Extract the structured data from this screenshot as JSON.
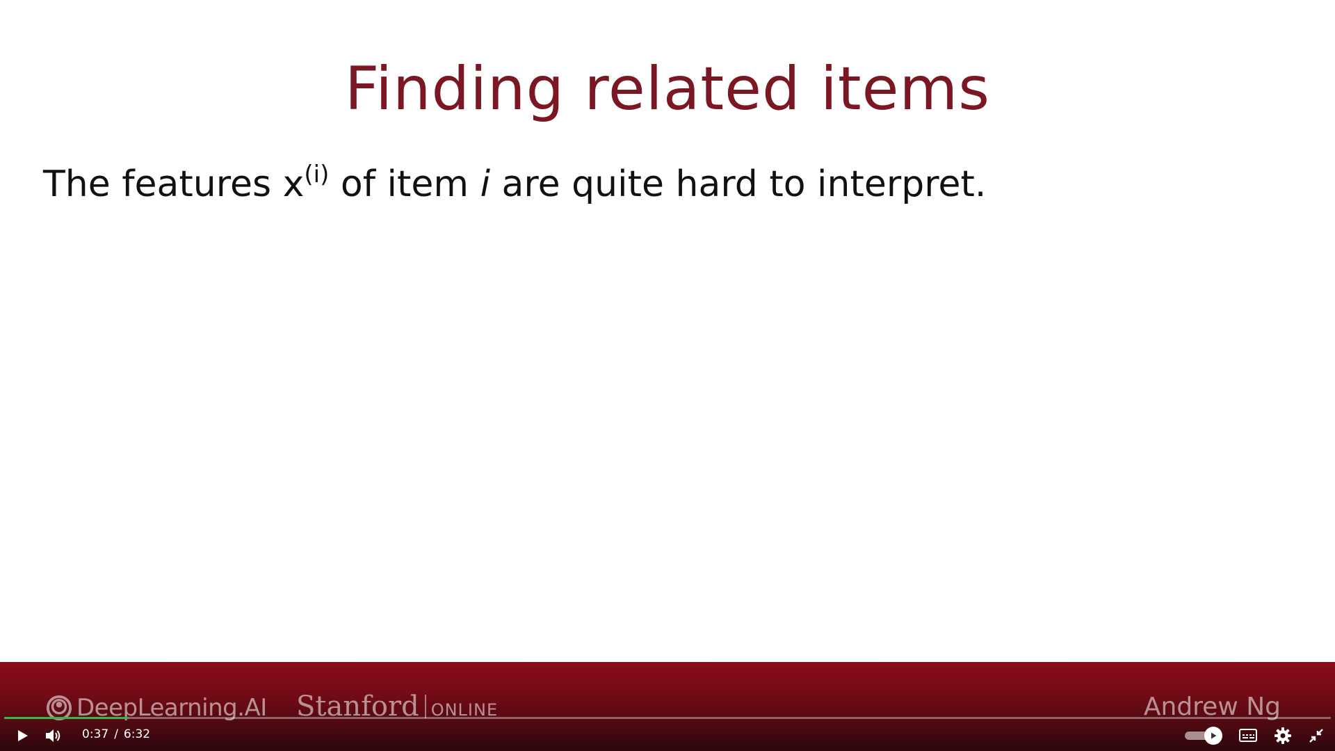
{
  "slide": {
    "title": "Finding related items",
    "body_prefix": "The features x",
    "body_superscript": "(i)",
    "body_mid": " of item ",
    "body_italic": "i",
    "body_suffix": " are quite hard to interpret."
  },
  "footer": {
    "brand_deeplearning": "DeepLearning.AI",
    "brand_stanford": "Stanford",
    "brand_online": "ONLINE",
    "author": "Andrew Ng"
  },
  "player": {
    "current_time": "0:37",
    "time_separator": "/",
    "duration": "6:32",
    "progress_fraction": 0.094,
    "autoplay_on": true,
    "colors": {
      "progress": "#3bb54a",
      "band_top": "#8a0d1a",
      "title": "#7b1722"
    },
    "icons": [
      "play-icon",
      "volume-icon",
      "autoplay-toggle",
      "captions-icon",
      "settings-icon",
      "exit-fullscreen-icon"
    ]
  }
}
